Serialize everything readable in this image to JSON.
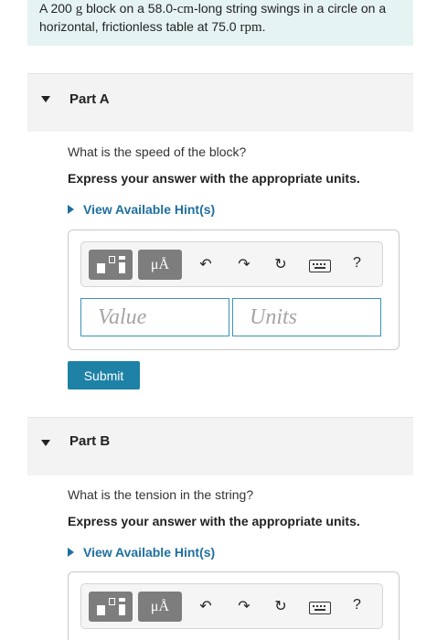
{
  "problem": {
    "text_1": "A 200 ",
    "unit_g": "g",
    "text_2": " block on a 58.0-",
    "unit_cm": "cm",
    "text_3": "-long string swings in a circle on a horizontal, frictionless table at 75.0 ",
    "unit_rpm": "rpm",
    "text_4": "."
  },
  "part_a": {
    "title": "Part A",
    "question": "What is the speed of the block?",
    "instruction": "Express your answer with the appropriate units.",
    "hint_label": "View Available Hint(s)",
    "value_placeholder": "Value",
    "units_placeholder": "Units",
    "submit_label": "Submit"
  },
  "part_b": {
    "title": "Part B",
    "question": "What is the tension in the string?",
    "instruction": "Express your answer with the appropriate units.",
    "hint_label": "View Available Hint(s)"
  },
  "toolbar": {
    "mu_label": "μÅ",
    "undo_glyph": "↶",
    "redo_glyph": "↷",
    "reset_glyph": "↻",
    "help_label": "?",
    "icons": [
      "templates-icon",
      "units-icon",
      "undo-icon",
      "redo-icon",
      "reset-icon",
      "keyboard-icon",
      "help-icon"
    ]
  },
  "colors": {
    "accent": "#1e81a6",
    "hint_link": "#1e6fa0",
    "problem_bg": "#e6f3f3",
    "part_header_bg": "#f3f3f3"
  }
}
